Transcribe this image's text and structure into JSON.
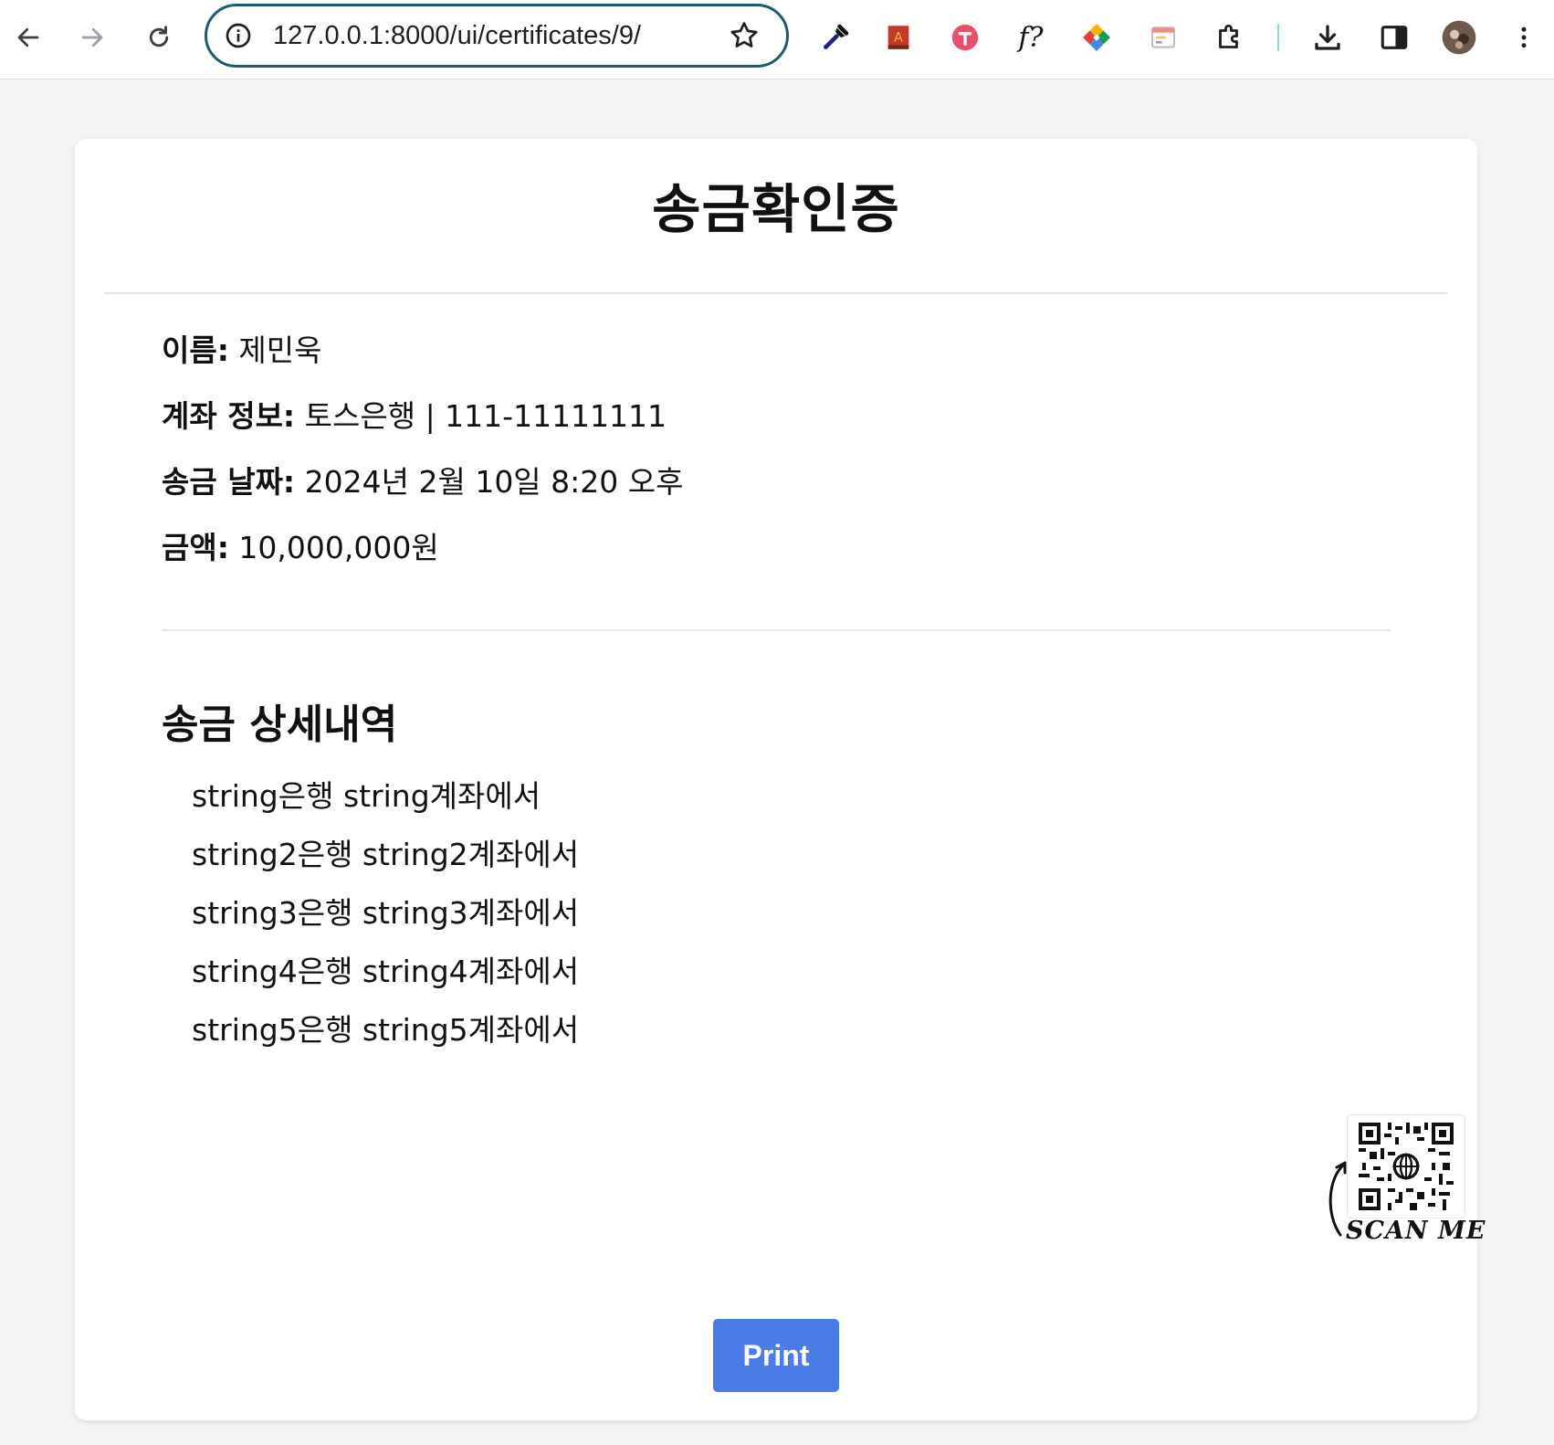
{
  "browser": {
    "url": "127.0.0.1:8000/ui/certificates/9/",
    "extensions": [
      "eyedropper-icon",
      "book-icon",
      "pink-circle-icon",
      "f-question-icon",
      "color-diamond-icon",
      "window-icon",
      "puzzle-icon"
    ],
    "f_ext_label": "f?"
  },
  "certificate": {
    "title": "송금확인증",
    "name_label": "이름:",
    "name_value": "제민욱",
    "account_label": "계좌 정보:",
    "account_value": "토스은행 | 111-11111111",
    "date_label": "송금 날짜:",
    "date_value": "2024년 2월 10일 8:20 오후",
    "amount_label": "금액:",
    "amount_value": "10,000,000원"
  },
  "details": {
    "title": "송금 상세내역",
    "items": [
      "string은행 string계좌에서",
      "string2은행 string2계좌에서",
      "string3은행 string3계좌에서",
      "string4은행 string4계좌에서",
      "string5은행 string5계좌에서"
    ]
  },
  "qr": {
    "caption": "SCAN ME"
  },
  "actions": {
    "print_label": "Print"
  },
  "colors": {
    "page_bg": "#f3f4f6",
    "card_bg": "#ffffff",
    "button": "#4a7ce8",
    "omnibox_border": "#1f5c6b"
  }
}
